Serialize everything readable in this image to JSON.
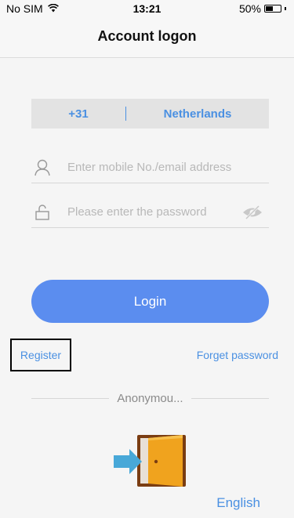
{
  "status_bar": {
    "carrier": "No SIM",
    "time": "13:21",
    "battery": "50%",
    "battery_level": 0.5
  },
  "nav": {
    "title": "Account logon"
  },
  "country": {
    "code": "+31",
    "name": "Netherlands"
  },
  "inputs": {
    "account_placeholder": "Enter mobile No./email address",
    "password_placeholder": "Please enter the password"
  },
  "actions": {
    "login": "Login",
    "register": "Register",
    "forget_password": "Forget password"
  },
  "anonymous": {
    "label": "Anonymou..."
  },
  "language": {
    "label": "English"
  },
  "colors": {
    "accent": "#4a90e2",
    "button": "#5b8def"
  },
  "icons": {
    "wifi": "wifi-icon",
    "battery": "battery-icon",
    "user": "user-icon",
    "lock": "lock-icon",
    "eye": "eye-hidden-icon",
    "door": "anonymous-door-icon"
  }
}
